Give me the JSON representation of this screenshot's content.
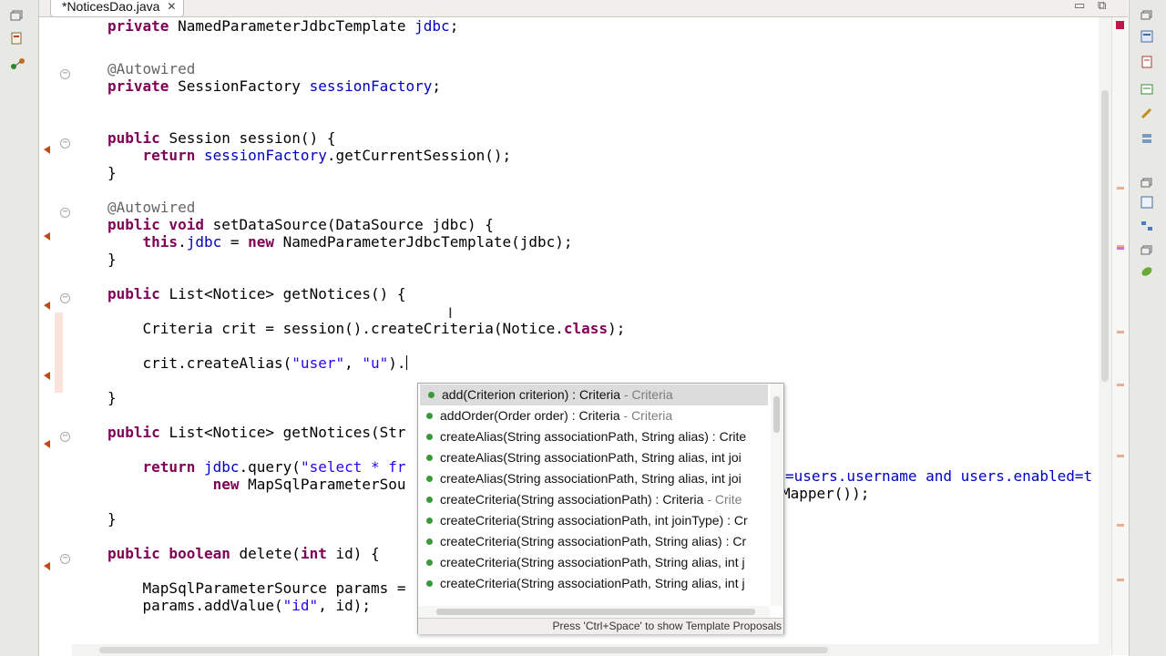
{
  "editor_tab": {
    "title": "*NoticesDao.java",
    "close_glyph": "✕"
  },
  "window_controls": {
    "minimize": "▭",
    "maximize": "⧉"
  },
  "code_lines": [
    {
      "tokens": [
        [
          "kw",
          "private "
        ],
        [
          "",
          "NamedParameterJdbcTemplate "
        ],
        [
          "fld",
          "jdbc"
        ],
        [
          "",
          ";"
        ]
      ]
    },
    {
      "tokens": [
        [
          "ann",
          "@Autowired"
        ]
      ]
    },
    {
      "tokens": [
        [
          "kw",
          "private "
        ],
        [
          "",
          "SessionFactory "
        ],
        [
          "fld",
          "sessionFactory"
        ],
        [
          "",
          ";"
        ]
      ]
    },
    {
      "tokens": [
        [
          "kw",
          "public "
        ],
        [
          "",
          "Session session() {"
        ]
      ]
    },
    {
      "tokens": [
        [
          "kw",
          "    return "
        ],
        [
          "fld",
          "sessionFactory"
        ],
        [
          "",
          ".getCurrentSession();"
        ]
      ]
    },
    {
      "tokens": [
        [
          "",
          "}"
        ]
      ]
    },
    {
      "tokens": [
        [
          "ann",
          "@Autowired"
        ]
      ]
    },
    {
      "tokens": [
        [
          "kw",
          "public void "
        ],
        [
          "",
          "setDataSource(DataSource jdbc) {"
        ]
      ]
    },
    {
      "tokens": [
        [
          "kw",
          "    this"
        ],
        [
          "",
          "."
        ],
        [
          "fld",
          "jdbc"
        ],
        [
          "",
          " = "
        ],
        [
          "kw",
          "new "
        ],
        [
          "",
          "NamedParameterJdbcTemplate(jdbc);"
        ]
      ]
    },
    {
      "tokens": [
        [
          "",
          "}"
        ]
      ]
    },
    {
      "tokens": [
        [
          "kw",
          "public "
        ],
        [
          "",
          "List<Notice> getNotices() {"
        ]
      ]
    },
    {
      "tokens": [
        [
          "",
          "    Criteria crit = session().createCriteria(Notice."
        ],
        [
          "kw",
          "class"
        ],
        [
          "",
          ");"
        ]
      ]
    },
    {
      "tokens": [
        [
          "",
          "    crit.createAlias("
        ],
        [
          "str",
          "\"user\""
        ],
        [
          "",
          ", "
        ],
        [
          "str",
          "\"u\""
        ],
        [
          "",
          ")."
        ]
      ]
    },
    {
      "tokens": [
        [
          "",
          "}"
        ]
      ]
    },
    {
      "tokens": [
        [
          "kw",
          "public "
        ],
        [
          "",
          "List<Notice> getNotices(Str"
        ]
      ]
    },
    {
      "tokens": [
        [
          "kw",
          "    return "
        ],
        [
          "fld",
          "jdbc"
        ],
        [
          "",
          ".query("
        ],
        [
          "str",
          "\"select * fr"
        ]
      ]
    },
    {
      "tokens": [
        [
          "kw",
          "            new "
        ],
        [
          "",
          "MapSqlParameterSou"
        ]
      ]
    },
    {
      "tokens": [
        [
          "",
          "}"
        ]
      ]
    },
    {
      "tokens": [
        [
          "kw",
          "public boolean "
        ],
        [
          "",
          "delete("
        ],
        [
          "kw",
          "int "
        ],
        [
          "",
          "id) {"
        ]
      ]
    },
    {
      "tokens": [
        [
          "",
          "    MapSqlParameterSource params = "
        ]
      ]
    },
    {
      "tokens": [
        [
          "",
          "    params.addValue("
        ],
        [
          "str",
          "\"id\""
        ],
        [
          "",
          ", id);"
        ]
      ]
    }
  ],
  "hidden_code_fragments": {
    "query_tail": "=users.username and users.enabled=t",
    "mapper_tail": "Mapper());"
  },
  "completion": {
    "items": [
      {
        "sig": "add(Criterion criterion) : Criteria",
        "decl": " - Criteria"
      },
      {
        "sig": "addOrder(Order order) : Criteria",
        "decl": " - Criteria"
      },
      {
        "sig": "createAlias(String associationPath, String alias) : Crite",
        "decl": ""
      },
      {
        "sig": "createAlias(String associationPath, String alias, int joi",
        "decl": ""
      },
      {
        "sig": "createAlias(String associationPath, String alias, int joi",
        "decl": ""
      },
      {
        "sig": "createCriteria(String associationPath) : Criteria",
        "decl": " - Crite"
      },
      {
        "sig": "createCriteria(String associationPath, int joinType) : Cr",
        "decl": ""
      },
      {
        "sig": "createCriteria(String associationPath, String alias) : Cr",
        "decl": ""
      },
      {
        "sig": "createCriteria(String associationPath, String alias, int j",
        "decl": ""
      },
      {
        "sig": "createCriteria(String associationPath, String alias, int j",
        "decl": ""
      }
    ],
    "selected_index": 0,
    "footer": "Press 'Ctrl+Space' to show Template Proposals"
  },
  "colors": {
    "keyword": "#7f0055",
    "field": "#0000c0",
    "string": "#2a00ff",
    "annotation": "#646464",
    "current_line": "#e8f2fe",
    "selection": "#dcdcdc"
  }
}
